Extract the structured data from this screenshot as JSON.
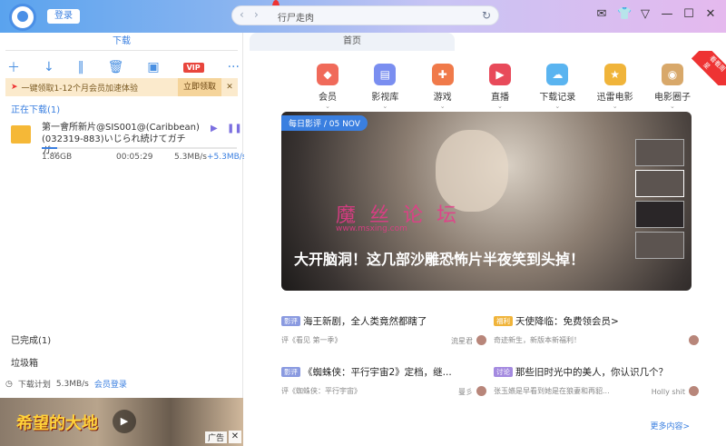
{
  "header": {
    "login_label": "登录",
    "address_text": "行尸走肉",
    "nav_back": "‹",
    "nav_forward": "›",
    "refresh_icon": "↻"
  },
  "left_panel": {
    "tab_label": "下载",
    "promo": {
      "text": "一键领取1-12个月会员加速体验",
      "claim_label": "立即领取",
      "close": "✕"
    },
    "section_downloading": "正在下载(1)",
    "download_item": {
      "title": "第一會所新片@SIS001@(Caribbean)(032319-883)いじられ続けてガチガ...",
      "size": "1.86GB",
      "time": "00:05:29",
      "speed": "5.3MB/s",
      "accel": "+5.3MB/s",
      "progress_fraction": 0.08
    },
    "section_completed": "已完成(1)",
    "section_trash": "垃圾箱",
    "plan": {
      "label": "下载计划",
      "speed": "5.3MB/s",
      "member_login": "会员登录"
    },
    "ad": {
      "headline": "希望的大地",
      "label": "广告",
      "close": "✕"
    }
  },
  "right_panel": {
    "tab_label": "首页",
    "ribbon_text": "看看周星",
    "categories": [
      {
        "label": "会员",
        "icon": "diamond-icon",
        "color": "#f06a5a",
        "glyph": "◆"
      },
      {
        "label": "影视库",
        "icon": "film-icon",
        "color": "#7a8ef0",
        "glyph": "▤"
      },
      {
        "label": "游戏",
        "icon": "game-icon",
        "color": "#f07a4a",
        "glyph": "✚"
      },
      {
        "label": "直播",
        "icon": "tv-icon",
        "color": "#e84a5a",
        "glyph": "▶"
      },
      {
        "label": "下载记录",
        "icon": "cloud-icon",
        "color": "#5ab4f0",
        "glyph": "☁"
      },
      {
        "label": "迅雷电影",
        "icon": "trophy-icon",
        "color": "#f0b43a",
        "glyph": "★"
      },
      {
        "label": "电影圈子",
        "icon": "circle-icon",
        "color": "#d8a86a",
        "glyph": "◉"
      }
    ],
    "hero": {
      "tag": "每日影评 / 05 NOV",
      "headline": "大开脑洞！这几部沙雕恐怖片半夜笑到头掉！",
      "watermark": "魔 丝 论 坛",
      "watermark_url": "www.msxing.com"
    },
    "news": [
      {
        "badge": "影评",
        "badge_color": "#8a9ae0",
        "title": "海王新剧，全人类竟然都瞎了",
        "sub": "评《看见 第一季》",
        "author": "流星君"
      },
      {
        "badge": "福利",
        "badge_color": "#f0b43a",
        "title": "天使降临：免费领会员>",
        "sub": "奇迹新生，新版本新福利！",
        "author": ""
      },
      {
        "badge": "影评",
        "badge_color": "#8a9ae0",
        "title": "《蜘蛛侠：平行宇宙2》定档，继...",
        "sub": "评《蜘蛛侠：平行宇宙》",
        "author": "曼彡"
      },
      {
        "badge": "讨论",
        "badge_color": "#a48ae0",
        "title": "那些旧时光中的美人，你认识几个？",
        "sub": "张玉嬿是早看到她是在狼妻和再貂...",
        "author": "Holly shit"
      }
    ],
    "more_label": "更多内容>"
  }
}
